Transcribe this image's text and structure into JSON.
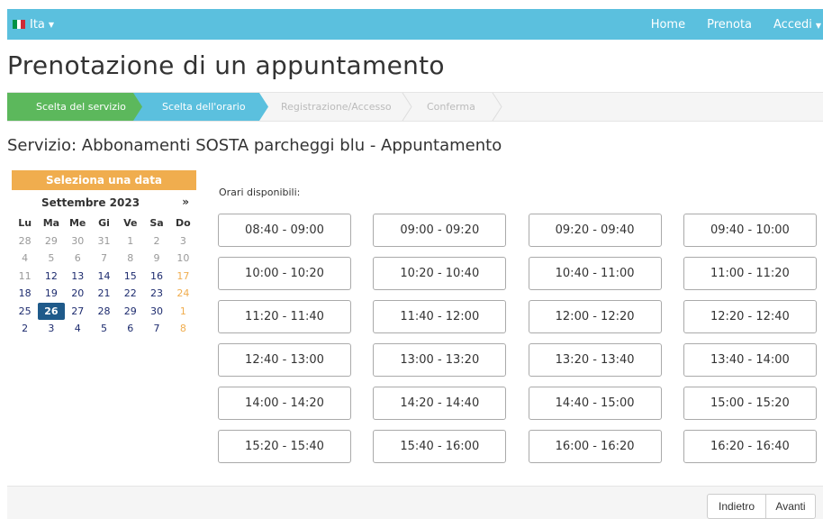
{
  "topbar": {
    "language": "Ita",
    "flag_colors": [
      "#009246",
      "#ffffff",
      "#ce2b37"
    ],
    "nav": [
      "Home",
      "Prenota",
      "Accedi"
    ]
  },
  "page_title": "Prenotazione di un appuntamento",
  "steps": [
    {
      "label": "Scelta del servizio",
      "state": "done"
    },
    {
      "label": "Scelta dell'orario",
      "state": "active"
    },
    {
      "label": "Registrazione/Accesso",
      "state": "todo"
    },
    {
      "label": "Conferma",
      "state": "todo"
    }
  ],
  "service_title": "Servizio: Abbonamenti SOSTA parcheggi blu - Appuntamento",
  "calendar": {
    "header": "Seleziona una data",
    "month": "Settembre 2023",
    "next": "»",
    "weekdays": [
      "Lu",
      "Ma",
      "Me",
      "Gi",
      "Ve",
      "Sa",
      "Do"
    ],
    "weeks": [
      [
        {
          "d": "28",
          "t": "dim"
        },
        {
          "d": "29",
          "t": "dim"
        },
        {
          "d": "30",
          "t": "dim"
        },
        {
          "d": "31",
          "t": "dim"
        },
        {
          "d": "1",
          "t": "dim"
        },
        {
          "d": "2",
          "t": "dim"
        },
        {
          "d": "3",
          "t": "dim"
        }
      ],
      [
        {
          "d": "4",
          "t": "dim"
        },
        {
          "d": "5",
          "t": "dim"
        },
        {
          "d": "6",
          "t": "dim"
        },
        {
          "d": "7",
          "t": "dim"
        },
        {
          "d": "8",
          "t": "dim"
        },
        {
          "d": "9",
          "t": "dim"
        },
        {
          "d": "10",
          "t": "dim"
        }
      ],
      [
        {
          "d": "11",
          "t": "dim"
        },
        {
          "d": "12",
          "t": "avail"
        },
        {
          "d": "13",
          "t": "avail"
        },
        {
          "d": "14",
          "t": "avail"
        },
        {
          "d": "15",
          "t": "avail"
        },
        {
          "d": "16",
          "t": "avail"
        },
        {
          "d": "17",
          "t": "wk"
        }
      ],
      [
        {
          "d": "18",
          "t": "avail"
        },
        {
          "d": "19",
          "t": "avail"
        },
        {
          "d": "20",
          "t": "avail"
        },
        {
          "d": "21",
          "t": "avail"
        },
        {
          "d": "22",
          "t": "avail"
        },
        {
          "d": "23",
          "t": "avail"
        },
        {
          "d": "24",
          "t": "wk"
        }
      ],
      [
        {
          "d": "25",
          "t": "avail"
        },
        {
          "d": "26",
          "t": "sel"
        },
        {
          "d": "27",
          "t": "avail"
        },
        {
          "d": "28",
          "t": "avail"
        },
        {
          "d": "29",
          "t": "avail"
        },
        {
          "d": "30",
          "t": "avail"
        },
        {
          "d": "1",
          "t": "wk"
        }
      ],
      [
        {
          "d": "2",
          "t": "avail"
        },
        {
          "d": "3",
          "t": "avail"
        },
        {
          "d": "4",
          "t": "avail"
        },
        {
          "d": "5",
          "t": "avail"
        },
        {
          "d": "6",
          "t": "avail"
        },
        {
          "d": "7",
          "t": "avail"
        },
        {
          "d": "8",
          "t": "wk"
        }
      ]
    ]
  },
  "orari_label": "Orari disponibili:",
  "slots": [
    "08:40 - 09:00",
    "09:00 - 09:20",
    "09:20 - 09:40",
    "09:40 - 10:00",
    "10:00 - 10:20",
    "10:20 - 10:40",
    "10:40 - 11:00",
    "11:00 - 11:20",
    "11:20 - 11:40",
    "11:40 - 12:00",
    "12:00 - 12:20",
    "12:20 - 12:40",
    "12:40 - 13:00",
    "13:00 - 13:20",
    "13:20 - 13:40",
    "13:40 - 14:00",
    "14:00 - 14:20",
    "14:20 - 14:40",
    "14:40 - 15:00",
    "15:00 - 15:20",
    "15:20 - 15:40",
    "15:40 - 16:00",
    "16:00 - 16:20",
    "16:20 - 16:40"
  ],
  "footer": {
    "back": "Indietro",
    "next": "Avanti"
  },
  "colors": {
    "topbar": "#5bc0de",
    "step_done": "#5cb85c",
    "step_active": "#5bc0de",
    "calendar_header": "#f0ad4e",
    "selected_day": "#1f5a8a"
  }
}
